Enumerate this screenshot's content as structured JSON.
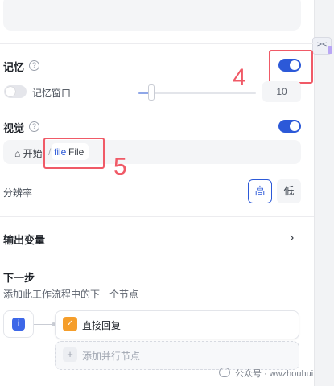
{
  "memory": {
    "title": "记忆",
    "toggle_on": true,
    "window_label": "记忆窗口",
    "window_toggle_on": false,
    "window_value": "10"
  },
  "vision": {
    "title": "视觉",
    "toggle_on": true,
    "breadcrumb": {
      "home_label": "开始",
      "separator": "/",
      "file_key": "file",
      "file_name": "File"
    }
  },
  "resolution": {
    "label": "分辨率",
    "options": [
      "高",
      "低"
    ],
    "selected": "高"
  },
  "output_variables": {
    "title": "输出变量"
  },
  "next_step": {
    "title": "下一步",
    "description": "添加此工作流程中的下一个节点",
    "node_label": "直接回复",
    "add_parallel_label": "添加并行节点"
  },
  "annotations": {
    "label_4": "4",
    "label_5": "5"
  },
  "watermark": {
    "text": "公众号 · wwzhouhui"
  },
  "colors": {
    "accent": "#2c59d8",
    "annotation": "#f05a67",
    "node_orange": "#f59e2b"
  }
}
